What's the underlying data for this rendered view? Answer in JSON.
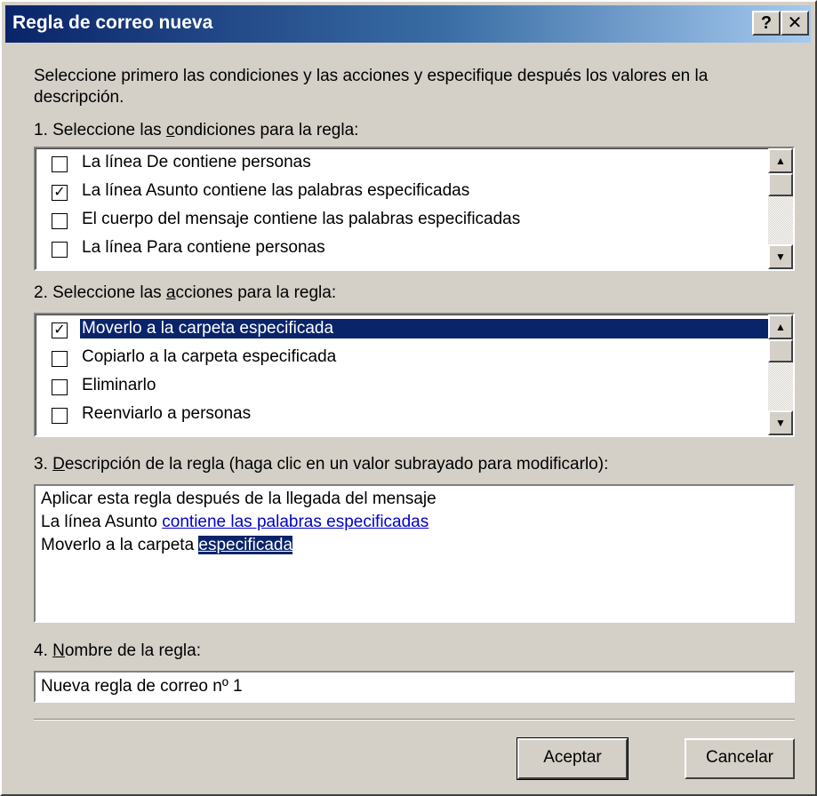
{
  "window": {
    "title": "Regla de correo nueva",
    "help_glyph": "?",
    "close_glyph": "✕"
  },
  "intro": "Seleccione primero las condiciones y las acciones y especifique después los valores en la descripción.",
  "conditions": {
    "label_pre": "1. Seleccione las ",
    "label_accel": "c",
    "label_post": "ondiciones para la regla:",
    "items": [
      {
        "label": "La línea De contiene personas",
        "checked": false
      },
      {
        "label": "La línea Asunto contiene las palabras especificadas",
        "checked": true
      },
      {
        "label": "El cuerpo del mensaje contiene las palabras especificadas",
        "checked": false
      },
      {
        "label": "La línea Para contiene personas",
        "checked": false
      }
    ]
  },
  "actions": {
    "label_pre": "2. Seleccione las ",
    "label_accel": "a",
    "label_post": "cciones para la regla:",
    "items": [
      {
        "label": "Moverlo a la carpeta especificada",
        "checked": true,
        "selected": true
      },
      {
        "label": "Copiarlo a la carpeta especificada",
        "checked": false
      },
      {
        "label": "Eliminarlo",
        "checked": false
      },
      {
        "label": "Reenviarlo a personas",
        "checked": false
      }
    ]
  },
  "description": {
    "label_pre": "3. ",
    "label_accel": "D",
    "label_post": "escripción de la regla (haga clic en un valor subrayado para modificarlo):",
    "line1": "Aplicar esta regla después de la llegada del mensaje",
    "line2_text": "La línea Asunto ",
    "line2_link": "contiene las palabras especificadas",
    "line3_text": "Moverlo a la carpeta ",
    "line3_link": "especificada"
  },
  "rule_name": {
    "label_pre": "4. ",
    "label_accel": "N",
    "label_post": "ombre de la regla:",
    "value": "Nueva regla de correo nº 1"
  },
  "buttons": {
    "ok": "Aceptar",
    "cancel": "Cancelar"
  },
  "colors": {
    "face": "#d4d0c8",
    "title_start": "#0a246a",
    "title_end": "#a6caf0",
    "selection": "#0a246a",
    "link": "#0000cc"
  },
  "icons": {
    "check": "✓",
    "scroll_up": "▲",
    "scroll_down": "▼"
  }
}
